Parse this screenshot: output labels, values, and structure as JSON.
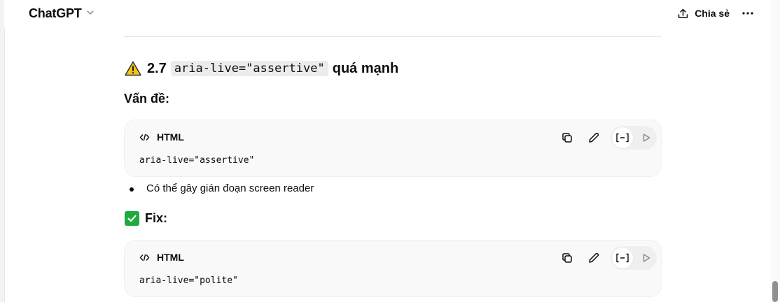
{
  "header": {
    "model_name": "ChatGPT",
    "share_label": "Chia sẻ"
  },
  "content": {
    "heading_number": "2.7",
    "heading_code": "aria-live=\"assertive\"",
    "heading_suffix": "quá mạnh",
    "problem_label": "Vấn đề:",
    "problem_code": {
      "language": "HTML",
      "code": "aria-live=\"assertive\""
    },
    "bullets": [
      "Có thể gây gián đoạn screen reader"
    ],
    "fix_label": "Fix:",
    "fix_code": {
      "language": "HTML",
      "code": "aria-live=\"polite\""
    }
  },
  "colors": {
    "warning": "#f5c518",
    "check": "#1faa41",
    "code_bg": "#f9f9f9"
  },
  "icons": [
    "chevron-down-icon",
    "share-icon",
    "more-icon",
    "warning-icon",
    "code-icon",
    "copy-icon",
    "edit-icon",
    "code-view-icon",
    "play-icon",
    "checkmark-icon"
  ]
}
